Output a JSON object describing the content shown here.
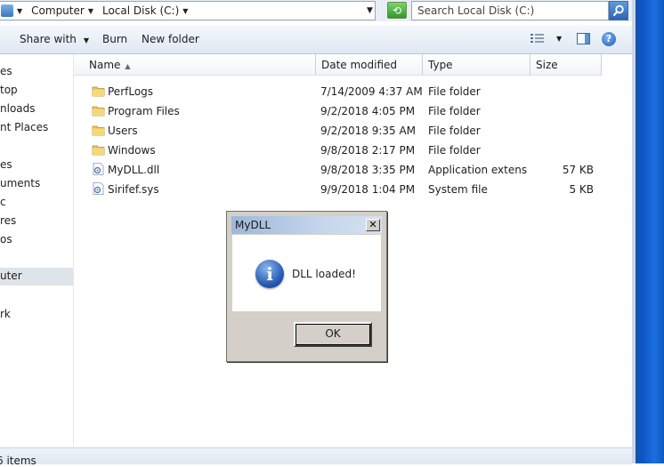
{
  "address": {
    "crumbs": [
      "Computer",
      "Local Disk (C:)"
    ],
    "search_placeholder": "Search Local Disk (C:)"
  },
  "toolbar": {
    "share_with": "Share with",
    "burn": "Burn",
    "new_folder": "New folder",
    "help": "?"
  },
  "nav": {
    "items": [
      "es",
      "top",
      "nloads",
      "nt Places",
      "es",
      "uments",
      "c",
      "res",
      "os",
      "uter",
      "rk"
    ]
  },
  "columns": {
    "name": "Name",
    "date": "Date modified",
    "type": "Type",
    "size": "Size"
  },
  "files": [
    {
      "name": "PerfLogs",
      "date": "7/14/2009 4:37 AM",
      "type": "File folder",
      "size": "",
      "icon": "folder-icon"
    },
    {
      "name": "Program Files",
      "date": "9/2/2018 4:05 PM",
      "type": "File folder",
      "size": "",
      "icon": "folder-icon"
    },
    {
      "name": "Users",
      "date": "9/2/2018 9:35 AM",
      "type": "File folder",
      "size": "",
      "icon": "folder-icon"
    },
    {
      "name": "Windows",
      "date": "9/8/2018 2:17 PM",
      "type": "File folder",
      "size": "",
      "icon": "folder-icon"
    },
    {
      "name": "MyDLL.dll",
      "date": "9/8/2018 3:35 PM",
      "type": "Application extens...",
      "size": "57 KB",
      "icon": "dll-file-icon"
    },
    {
      "name": "Sirifef.sys",
      "date": "9/9/2018 1:04 PM",
      "type": "System file",
      "size": "5 KB",
      "icon": "sys-file-icon"
    }
  ],
  "status": {
    "text": "6 items"
  },
  "dialog": {
    "title": "MyDLL",
    "close": "✕",
    "icon": "i",
    "message": "DLL loaded!",
    "ok": "OK"
  },
  "colors": {
    "folder": "#e8c45a",
    "accent": "#2456b0"
  }
}
